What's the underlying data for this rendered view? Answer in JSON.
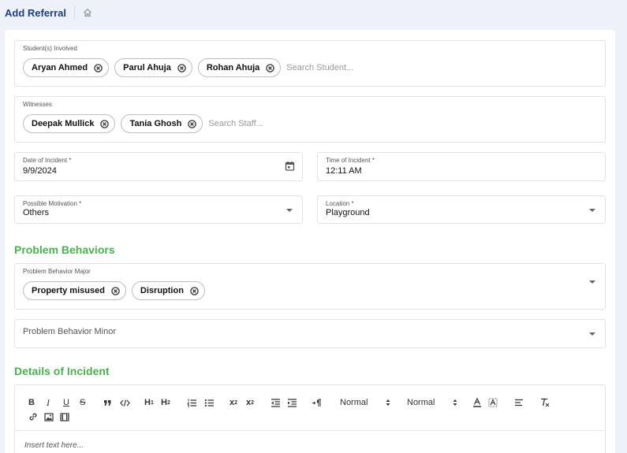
{
  "header": {
    "title": "Add Referral",
    "home_icon": "home-icon"
  },
  "students": {
    "label": "Student(s) Involved",
    "chips": [
      "Aryan Ahmed",
      "Parul Ahuja",
      "Rohan Ahuja"
    ],
    "placeholder": "Search Student..."
  },
  "witnesses": {
    "label": "Witnesses",
    "chips": [
      "Deepak Mullick",
      "Tania Ghosh"
    ],
    "placeholder": "Search Staff..."
  },
  "date": {
    "label": "Date of Incident *",
    "value": "9/9/2024",
    "icon": "calendar-icon"
  },
  "time": {
    "label": "Time of Incident *",
    "value": "12:11 AM"
  },
  "motivation": {
    "label": "Possible Motivation *",
    "value": "Others"
  },
  "location": {
    "label": "Location *",
    "value": "Playground"
  },
  "problem_behaviors": {
    "heading": "Problem Behaviors",
    "major": {
      "label": "Problem Behavior Major",
      "chips": [
        "Property misused",
        "Disruption"
      ]
    },
    "minor": {
      "placeholder": "Problem Behavior Minor"
    }
  },
  "details": {
    "heading": "Details of Incident",
    "editor": {
      "header_sub_1": "1",
      "header_sub_2": "2",
      "subscript_sub": "2",
      "superscript_sup": "2",
      "format_1": "Normal",
      "format_2": "Normal",
      "placeholder": "Insert text here..."
    }
  },
  "colors": {
    "accent_green": "#4caf50",
    "title_blue": "#1f3f7a"
  }
}
